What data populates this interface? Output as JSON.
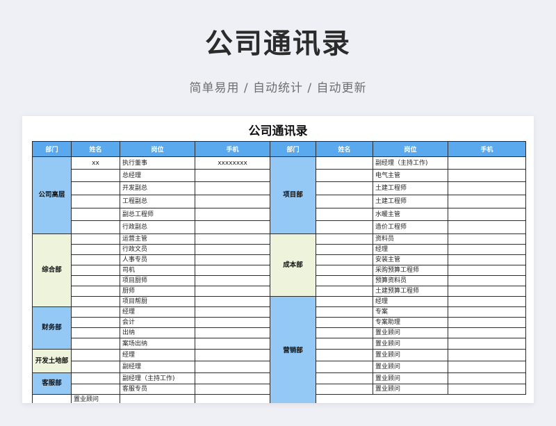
{
  "hero": {
    "title": "公司通讯录",
    "subtitle": "简单易用 / 自动统计 / 自动更新"
  },
  "sheet": {
    "title": "公司通讯录",
    "headers": [
      "部门",
      "姓名",
      "岗位",
      "手机",
      "部门",
      "姓名",
      "岗位",
      "手机"
    ],
    "left": [
      {
        "name": "公司高层",
        "color": "#94c8f5",
        "rows": [
          {
            "name": "xx",
            "post": "执行董事",
            "phone": "xxxxxxxx"
          },
          {
            "name": "",
            "post": "总经理",
            "phone": ""
          },
          {
            "name": "",
            "post": "开发副总",
            "phone": ""
          },
          {
            "name": "",
            "post": "工程副总",
            "phone": ""
          },
          {
            "name": "",
            "post": "副总工程师",
            "phone": ""
          },
          {
            "name": "",
            "post": "行政副总",
            "phone": ""
          }
        ]
      },
      {
        "name": "综合部",
        "color": "#eef3dc",
        "rows": [
          {
            "name": "",
            "post": "运营主管",
            "phone": ""
          },
          {
            "name": "",
            "post": "行政文员",
            "phone": ""
          },
          {
            "name": "",
            "post": "人事专员",
            "phone": ""
          },
          {
            "name": "",
            "post": "司机",
            "phone": ""
          },
          {
            "name": "",
            "post": "项目厨师",
            "phone": ""
          },
          {
            "name": "",
            "post": "厨师",
            "phone": ""
          },
          {
            "name": "",
            "post": "项目帮厨",
            "phone": ""
          }
        ]
      },
      {
        "name": "财务部",
        "color": "#94c8f5",
        "rows": [
          {
            "name": "",
            "post": "经理",
            "phone": ""
          },
          {
            "name": "",
            "post": "会计",
            "phone": ""
          },
          {
            "name": "",
            "post": "出纳",
            "phone": ""
          },
          {
            "name": "",
            "post": "案场出纳",
            "phone": ""
          }
        ]
      },
      {
        "name": "开发土地部",
        "color": "#eef3dc",
        "rows": [
          {
            "name": "",
            "post": "经理",
            "phone": ""
          },
          {
            "name": "",
            "post": "副经理",
            "phone": ""
          }
        ]
      },
      {
        "name": "客服部",
        "color": "#94c8f5",
        "rows": [
          {
            "name": "",
            "post": "副经理（主持工作)",
            "phone": ""
          },
          {
            "name": "",
            "post": "客服专员",
            "phone": ""
          }
        ]
      }
    ],
    "right": [
      {
        "name": "项目部",
        "color": "#94c8f5",
        "rows": [
          {
            "name": "",
            "post": "副经理（主持工作)",
            "phone": ""
          },
          {
            "name": "",
            "post": "电气主管",
            "phone": ""
          },
          {
            "name": "",
            "post": "土建工程师",
            "phone": ""
          },
          {
            "name": "",
            "post": "土建工程师",
            "phone": ""
          },
          {
            "name": "",
            "post": "水暖主管",
            "phone": ""
          },
          {
            "name": "",
            "post": "造价工程师",
            "phone": ""
          }
        ]
      },
      {
        "name": "成本部",
        "color": "#eef3dc",
        "rows": [
          {
            "name": "",
            "post": "资料员",
            "phone": ""
          },
          {
            "name": "",
            "post": "经理",
            "phone": ""
          },
          {
            "name": "",
            "post": "安装主管",
            "phone": ""
          },
          {
            "name": "",
            "post": "采购预算工程师",
            "phone": ""
          },
          {
            "name": "",
            "post": "预算资料员",
            "phone": ""
          },
          {
            "name": "",
            "post": "土建预算工程师",
            "phone": ""
          }
        ]
      },
      {
        "name": "营销部",
        "color": "#94c8f5",
        "rows": [
          {
            "name": "",
            "post": "经理",
            "phone": ""
          },
          {
            "name": "",
            "post": "专案",
            "phone": ""
          },
          {
            "name": "",
            "post": "专案助理",
            "phone": ""
          },
          {
            "name": "",
            "post": "置业顾问",
            "phone": ""
          },
          {
            "name": "",
            "post": "置业顾问",
            "phone": ""
          },
          {
            "name": "",
            "post": "置业顾问",
            "phone": ""
          },
          {
            "name": "",
            "post": "置业顾问",
            "phone": ""
          },
          {
            "name": "",
            "post": "置业顾问",
            "phone": ""
          },
          {
            "name": "",
            "post": "置业顾问",
            "phone": ""
          },
          {
            "name": "",
            "post": "置业顾问",
            "phone": ""
          }
        ]
      }
    ]
  }
}
